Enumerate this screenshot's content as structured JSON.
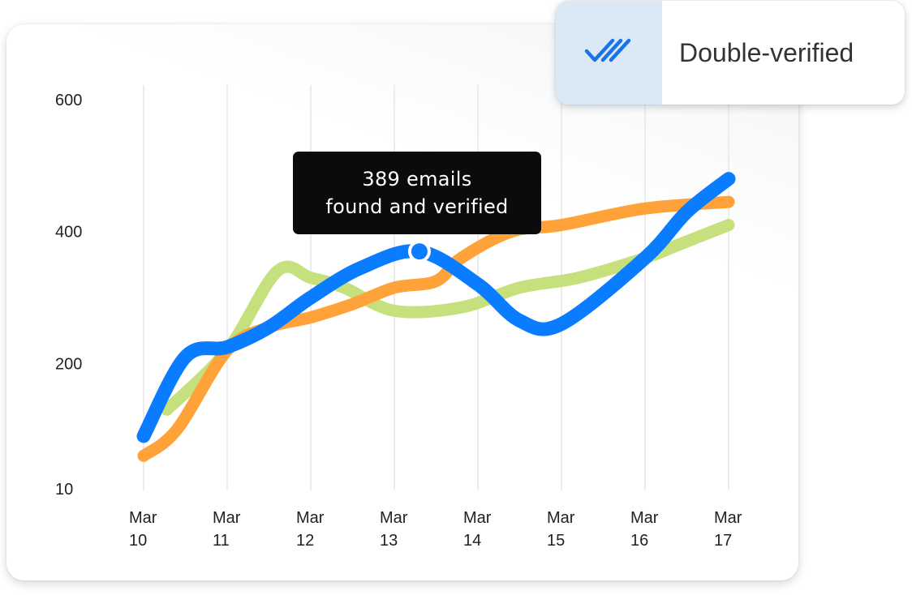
{
  "badge": {
    "label": "Double-verified",
    "icon": "double-check-icon",
    "icon_color": "#1a73e8",
    "icon_bg": "#dbe8f6"
  },
  "tooltip": {
    "line1": "389 emails",
    "line2": "found and verified"
  },
  "colors": {
    "blue": "#0a7cff",
    "orange": "#ffa23a",
    "green": "#c5e07c",
    "grid": "#ececec"
  },
  "chart_data": {
    "type": "line",
    "categories": [
      [
        "Mar",
        "10"
      ],
      [
        "Mar",
        "11"
      ],
      [
        "Mar",
        "12"
      ],
      [
        "Mar",
        "13"
      ],
      [
        "Mar",
        "14"
      ],
      [
        "Mar",
        "15"
      ],
      [
        "Mar",
        "16"
      ],
      [
        "Mar",
        "17"
      ]
    ],
    "x": [
      0,
      1,
      2,
      3,
      4,
      5,
      6,
      7
    ],
    "y_ticks": [
      {
        "value": 10,
        "label": "10"
      },
      {
        "value": 200,
        "label": "200"
      },
      {
        "value": 400,
        "label": "400"
      },
      {
        "value": 600,
        "label": "600"
      }
    ],
    "ylim": [
      10,
      600
    ],
    "grid": "vertical",
    "legend": "none",
    "series": [
      {
        "key": "green",
        "x": [
          0.28,
          1,
          1.6,
          2,
          2.4,
          3,
          3.8,
          4.5,
          5.2,
          6,
          6.4,
          7
        ],
        "values": [
          130,
          220,
          340,
          330,
          315,
          280,
          285,
          315,
          330,
          360,
          380,
          410
        ]
      },
      {
        "key": "orange",
        "x": [
          0,
          0.4,
          1,
          1.5,
          2,
          2.5,
          3,
          3.5,
          3.8,
          4.4,
          5,
          6,
          7
        ],
        "values": [
          60,
          100,
          220,
          255,
          270,
          290,
          315,
          325,
          360,
          400,
          410,
          435,
          445
        ]
      },
      {
        "key": "blue",
        "x": [
          0,
          0.5,
          1,
          1.5,
          2,
          2.6,
          3.3,
          4,
          4.5,
          5,
          6,
          6.5,
          7
        ],
        "values": [
          90,
          210,
          225,
          255,
          300,
          345,
          370,
          320,
          265,
          260,
          360,
          430,
          480
        ]
      }
    ],
    "highlight": {
      "series": "blue",
      "x": 3.3,
      "value": 389
    }
  }
}
